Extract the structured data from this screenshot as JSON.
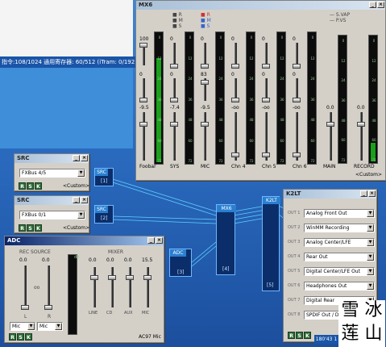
{
  "status": {
    "text": "指令:108/1024 通用寄存器: 60/512 (iTram: 0/192)"
  },
  "mx6": {
    "title": "MX6",
    "custom": "<Custom>",
    "header_flags": [
      "R",
      "M",
      "S"
    ],
    "right_flags": [
      "S.VAP",
      "P.VS"
    ],
    "channels": [
      {
        "name": "Foobar",
        "top": "100",
        "mid": "0",
        "low": "-9.5",
        "meter": 0.8
      },
      {
        "name": "SYS",
        "top": "0",
        "mid": "0",
        "low": "-7.4",
        "meter": 0.0
      },
      {
        "name": "MIC",
        "top": "0",
        "mid": "83",
        "low": "-9.5",
        "meter": 0.0
      },
      {
        "name": "Chn 4",
        "top": "0",
        "mid": "0",
        "low": "-oo",
        "meter": 0.0
      },
      {
        "name": "Chn 5",
        "top": "0",
        "mid": "0",
        "low": "-oo",
        "meter": 0.0
      },
      {
        "name": "Chn 6",
        "top": "0",
        "mid": "0",
        "low": "-oo",
        "meter": 0.0
      },
      {
        "name": "MAIN",
        "top": "",
        "mid": "",
        "low": "0.0",
        "meter": 0.0
      },
      {
        "name": "RECORD",
        "top": "",
        "mid": "",
        "low": "0.0",
        "meter": 0.15
      }
    ],
    "meter_ticks": [
      "0",
      "12",
      "24",
      "36",
      "48",
      "60",
      "72"
    ]
  },
  "src1": {
    "title": "SRC",
    "select": "FXBus 4/5",
    "custom": "<Custom>"
  },
  "src2": {
    "title": "SRC",
    "select": "FXBus 0/1",
    "custom": "<Custom>"
  },
  "adc": {
    "title": "ADC",
    "rec_source": "REC SOURCE",
    "mixer": "MIXER",
    "l_val": "0.0",
    "r_val": "0.0",
    "link": "oo",
    "l_label": "L",
    "r_label": "R",
    "sel_left": "Mic",
    "sel_right": "Mic",
    "mixer_vals": [
      "0.0",
      "0.0",
      "0.0",
      "15.5"
    ],
    "mixer_labels": [
      "LINE",
      "CD",
      "AUX",
      "MIC"
    ],
    "footer": "AC97 Mic",
    "db": "dB"
  },
  "nodes": {
    "src1": {
      "title": "SRC",
      "num": "[1]"
    },
    "src2": {
      "title": "SRC",
      "num": "[2]"
    },
    "adc": {
      "title": "ADC",
      "num": "[3]"
    },
    "mx6": {
      "title": "MX6",
      "num": "[4]"
    },
    "k2lt": {
      "title": "K2LT",
      "num": "[5]"
    }
  },
  "k2lt": {
    "title": "K2LT",
    "outputs": [
      {
        "label": "OUT 1",
        "value": "Analog Front Out"
      },
      {
        "label": "OUT 2",
        "value": "WinMM Recording"
      },
      {
        "label": "OUT 3",
        "value": "Analog Center/LFE"
      },
      {
        "label": "OUT 4",
        "value": "Rear Out"
      },
      {
        "label": "OUT 5",
        "value": "Digital Center/LFE Out"
      },
      {
        "label": "OUT 6",
        "value": "Headphones Out"
      },
      {
        "label": "OUT 7",
        "value": "Digital Rear"
      },
      {
        "label": "OUT 8",
        "value": "SPDIF Out / Dig..."
      }
    ],
    "footer_badge": "180'43 1"
  },
  "watermark": {
    "chars": [
      "雪",
      "冰",
      "莲",
      "山"
    ]
  },
  "colors": {
    "titlebar": "#0a246a",
    "node": "#0b2e6a",
    "wire": "#5fd0ff",
    "meter": "#1aa01a"
  }
}
